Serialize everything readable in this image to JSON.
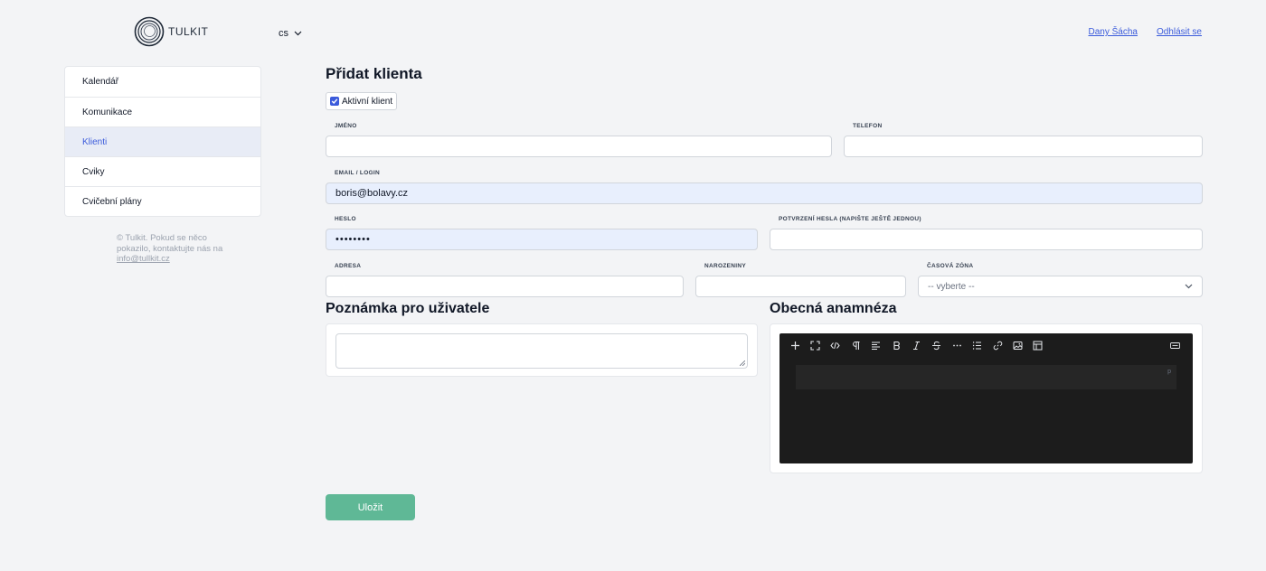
{
  "brand": {
    "name": "TULKIT"
  },
  "language": {
    "value": "cs"
  },
  "user_links": {
    "user_name": "Dany Šácha",
    "logout": "Odhlásit se"
  },
  "sidebar": {
    "items": [
      {
        "label": "Kalendář",
        "active": false
      },
      {
        "label": "Komunikace",
        "active": false
      },
      {
        "label": "Klienti",
        "active": true
      },
      {
        "label": "Cviky",
        "active": false
      },
      {
        "label": "Cvičební plány",
        "active": false
      }
    ],
    "footer": {
      "text": "© Tulkit. Pokud se něco pokazilo, kontaktujte nás na",
      "email": "info@tullkit.cz"
    }
  },
  "form": {
    "title": "Přidat klienta",
    "active_client": {
      "label": "Aktivní klient",
      "checked": true
    },
    "fields": {
      "name": {
        "label": "JMÉNO",
        "value": ""
      },
      "phone": {
        "label": "TELEFON",
        "value": ""
      },
      "email": {
        "label": "EMAIL / LOGIN",
        "value": "boris@bolavy.cz"
      },
      "password": {
        "label": "HESLO",
        "value": "••••••••"
      },
      "password_confirm": {
        "label": "POTVRZENÍ HESLA (NAPIŠTE JEŠTĚ JEDNOU)",
        "value": ""
      },
      "address": {
        "label": "ADRESA",
        "value": ""
      },
      "birthday": {
        "label": "NAROZENINY",
        "value": ""
      },
      "timezone": {
        "label": "ČASOVÁ ZÓNA",
        "value": "-- vyberte --"
      }
    },
    "note_section": {
      "title": "Poznámka pro uživatele"
    },
    "anamnesis_section": {
      "title": "Obecná anamnéza",
      "paragraph_marker": "p"
    },
    "editor_toolbar": [
      "plus-icon",
      "fullscreen-icon",
      "code-icon",
      "paragraph-icon",
      "align-icon",
      "bold-icon",
      "italic-icon",
      "strikethrough-icon",
      "more-icon",
      "list-icon",
      "link-icon",
      "image-icon",
      "table-icon",
      "keyboard-icon"
    ],
    "save_label": "Uložit"
  },
  "colors": {
    "accent": "#3b5bdb",
    "save": "#5fb896",
    "editor_bg": "#1c1c1c",
    "active_nav_bg": "#e8ecf6"
  }
}
